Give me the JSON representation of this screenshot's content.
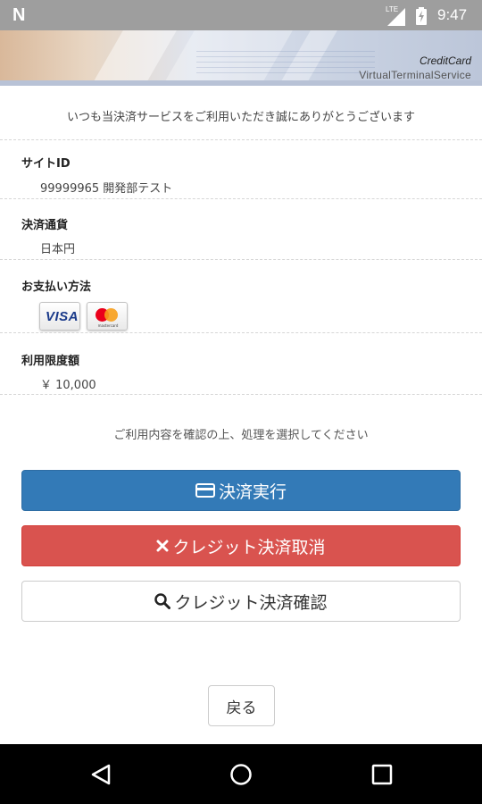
{
  "status_bar": {
    "left_icon": "n-icon",
    "network": "LTE",
    "time": "9:47"
  },
  "banner": {
    "line1": "CreditCard",
    "line2": "VirtualTerminalService"
  },
  "greeting": "いつも当決済サービスをご利用いただき誠にありがとうございます",
  "fields": {
    "site_id": {
      "label": "サイトID",
      "value": "99999965 開発部テスト"
    },
    "currency": {
      "label": "決済通貨",
      "value": "日本円"
    },
    "payment_method": {
      "label": "お支払い方法",
      "cards": [
        "VISA",
        "mastercard"
      ]
    },
    "limit": {
      "label": "利用限度額",
      "value": "￥ 10,000"
    }
  },
  "instruction": "ご利用内容を確認の上、処理を選択してください",
  "buttons": {
    "execute": {
      "label": "決済実行",
      "icon": "credit-card-icon",
      "color": "#337ab7"
    },
    "cancel": {
      "label": "クレジット決済取消",
      "icon": "close-icon",
      "color": "#d9534f"
    },
    "confirm": {
      "label": "クレジット決済確認",
      "icon": "search-icon",
      "color": "#ffffff"
    }
  },
  "back_label": "戻る",
  "nav": [
    "back-icon",
    "home-icon",
    "recents-icon"
  ]
}
